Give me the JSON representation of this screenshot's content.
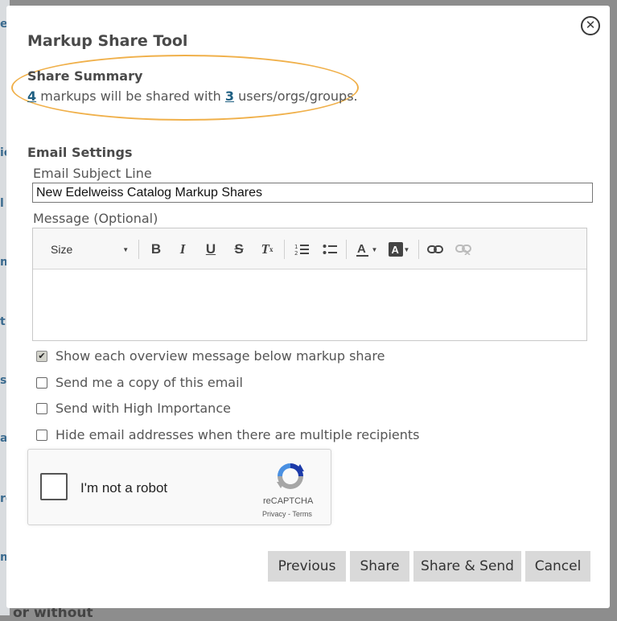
{
  "dialog": {
    "title": "Markup Share Tool",
    "close_icon": "close-circle-icon"
  },
  "summary": {
    "title": "Share Summary",
    "markup_count": "4",
    "text_middle": " markups will be shared with ",
    "recipient_count": "3",
    "text_end": " users/orgs/groups.",
    "highlight_color": "#f0b04a"
  },
  "email_settings": {
    "title": "Email Settings",
    "subject_label": "Email Subject Line",
    "subject_value": "New Edelweiss Catalog Markup Shares",
    "message_label": "Message (Optional)",
    "message_value": ""
  },
  "toolbar": {
    "size_label": "Size",
    "tools": [
      "bold-icon",
      "italic-icon",
      "underline-icon",
      "strikethrough-icon",
      "remove-format-icon",
      "numbered-list-icon",
      "bulleted-list-icon",
      "text-color-icon",
      "background-color-icon",
      "link-icon",
      "unlink-icon"
    ]
  },
  "options": [
    {
      "label": "Show each overview message below markup share",
      "checked": true
    },
    {
      "label": "Send me a copy of this email",
      "checked": false
    },
    {
      "label": "Send with High Importance",
      "checked": false
    },
    {
      "label": "Hide email addresses when there are multiple recipients",
      "checked": false
    }
  ],
  "captcha": {
    "label": "I'm not a robot",
    "brand": "reCAPTCHA",
    "privacy": "Privacy",
    "separator": " - ",
    "terms": "Terms"
  },
  "buttons": {
    "previous": "Previous",
    "share": "Share",
    "share_send": "Share & Send",
    "cancel": "Cancel"
  },
  "background": {
    "bottom_text": "or without"
  }
}
